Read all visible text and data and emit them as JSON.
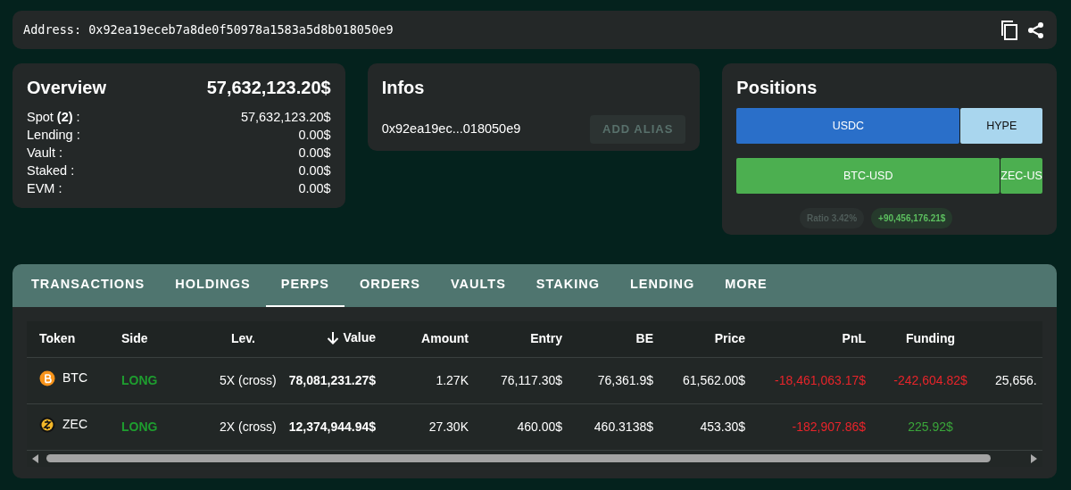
{
  "address_bar": {
    "label": "Address:",
    "value": "0x92ea19eceb7a8de0f50978a1583a5d8b018050e9"
  },
  "overview": {
    "title": "Overview",
    "total": "57,632,123.20$",
    "rows": [
      {
        "label": "Spot **(2)** :",
        "value": "57,632,123.20$"
      },
      {
        "label": "Lending :",
        "value": "0.00$"
      },
      {
        "label": "Vault :",
        "value": "0.00$"
      },
      {
        "label": "Staked :",
        "value": "0.00$"
      },
      {
        "label": "EVM :",
        "value": "0.00$"
      }
    ]
  },
  "infos": {
    "title": "Infos",
    "address": "0x92ea19ec...018050e9",
    "button": {
      "label": "ADD ALIAS",
      "disabled": true
    }
  },
  "positions": {
    "title": "Positions",
    "bars": [
      {
        "level": 0.73,
        "segments": [
          {
            "label": "USDC",
            "color": "#2a6fc9"
          },
          {
            "label": "HYPE",
            "color": "#a9d6ee"
          }
        ]
      },
      {
        "level": 0.86,
        "segments": [
          {
            "label": "BTC-USD",
            "color": "#4caf50"
          },
          {
            "label": "ZEC-US",
            "color": "#4caf50"
          }
        ]
      }
    ],
    "ratio": {
      "label": "Ratio",
      "value": "3.42%"
    },
    "pnl": "+90,456,176.21$"
  },
  "tabs": [
    {
      "label": "TRANSACTIONS",
      "selected": false
    },
    {
      "label": "HOLDINGS",
      "selected": false
    },
    {
      "label": "PERPS",
      "selected": true
    },
    {
      "label": "ORDERS",
      "selected": false
    },
    {
      "label": "VAULTS",
      "selected": false
    },
    {
      "label": "STAKING",
      "selected": false
    },
    {
      "label": "LENDING",
      "selected": false
    },
    {
      "label": "MORE",
      "selected": false
    }
  ],
  "table": {
    "columns": [
      {
        "label": "Token",
        "sorted": false
      },
      {
        "label": "Side",
        "sorted": false
      },
      {
        "label": "Lev.",
        "sorted": false
      },
      {
        "label": "Value",
        "sorted": true
      },
      {
        "label": "Amount",
        "sorted": false
      },
      {
        "label": "Entry",
        "sorted": false
      },
      {
        "label": "BE",
        "sorted": false
      },
      {
        "label": "Price",
        "sorted": false
      },
      {
        "label": "PnL",
        "sorted": false
      },
      {
        "label": "Funding",
        "sorted": false
      }
    ],
    "rows": [
      {
        "kind": "btc",
        "token": "BTC",
        "side": {
          "text": "LONG",
          "color": "#1e9e2f"
        },
        "lev": "5X (cross)",
        "value": "78,081,231.27$",
        "amount": "1.27K",
        "entry": "76,117.30$",
        "be": "76,361.9$",
        "price": "61,562.00$",
        "pnl": {
          "text": "-18,461,063.17$",
          "color": "#e8242a"
        },
        "funding": {
          "text": "-242,604.82$",
          "color": "#e8242a"
        },
        "column_11": "25,656."
      },
      {
        "kind": "zec",
        "token": "ZEC",
        "side": {
          "text": "LONG",
          "color": "#1e9e2f"
        },
        "lev": "2X (cross)",
        "value": "12,374,944.94$",
        "amount": "27.30K",
        "entry": "460.00$",
        "be": "460.3138$",
        "price": "453.30$",
        "pnl": {
          "text": "-182,907.86$",
          "color": "#e8242a"
        },
        "funding": {
          "text": "225.92$",
          "color": "#3aa53a"
        }
      }
    ]
  }
}
